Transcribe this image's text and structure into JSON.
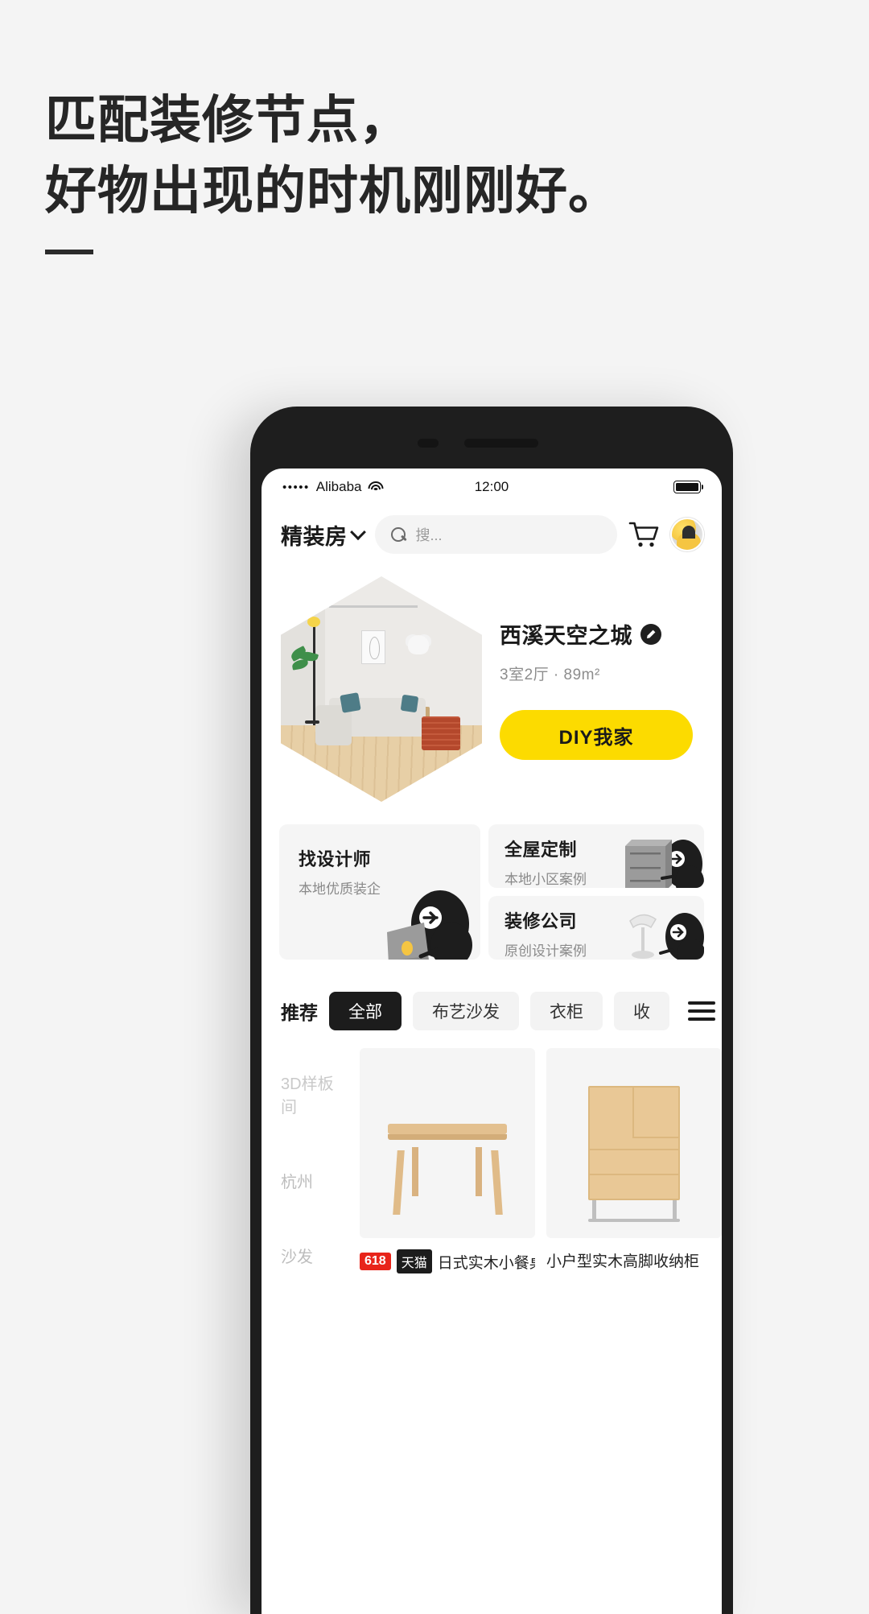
{
  "headline": {
    "line1": "匹配装修节点，",
    "line2": "好物出现的时机刚刚好。"
  },
  "phone": {
    "statusbar": {
      "signal_dots": "•••••",
      "carrier": "Alibaba",
      "wifi_icon": "wifi-icon",
      "time": "12:00",
      "battery_icon": "battery-full-icon"
    },
    "appbar": {
      "brand": "精装房",
      "chevron_icon": "chevron-down-icon",
      "search_placeholder": "搜...",
      "search_value": "",
      "search_icon": "search-icon",
      "cart_icon": "shopping-cart-icon",
      "avatar_icon": "user-avatar"
    },
    "hero": {
      "title": "西溪天空之城",
      "edit_icon": "pencil-edit-icon",
      "subtitle": "3室2厅 · 89m²",
      "cta_label": "DIY我家",
      "cta_color": "#fcdb00",
      "room_image": "living-room-hexagon-photo"
    },
    "services": [
      {
        "title": "找设计师",
        "subtitle": "本地优质装企",
        "mascot": "mascot-laptop"
      },
      {
        "title": "全屋定制",
        "subtitle": "本地小区案例",
        "mascot": "mascot-cabinet"
      },
      {
        "title": "装修公司",
        "subtitle": "原创设计案例",
        "mascot": "mascot-lamp"
      }
    ],
    "recommend": {
      "label": "推荐",
      "menu_icon": "hamburger-menu-icon",
      "chips": [
        {
          "label": "全部",
          "active": true
        },
        {
          "label": "布艺沙发",
          "active": false
        },
        {
          "label": "衣柜",
          "active": false
        },
        {
          "label": "收",
          "active": false
        }
      ]
    },
    "sidenav": [
      {
        "label": "3D样板间"
      },
      {
        "label": "杭州"
      },
      {
        "label": "沙发"
      }
    ],
    "products": [
      {
        "title": "日式实木小餐桌",
        "badge_618": "618",
        "badge_shop": "天猫",
        "image": "wooden-dining-table"
      },
      {
        "title": "小户型实木高脚收纳柜",
        "badge_618": "",
        "badge_shop": "",
        "image": "wooden-storage-cabinet"
      }
    ]
  }
}
